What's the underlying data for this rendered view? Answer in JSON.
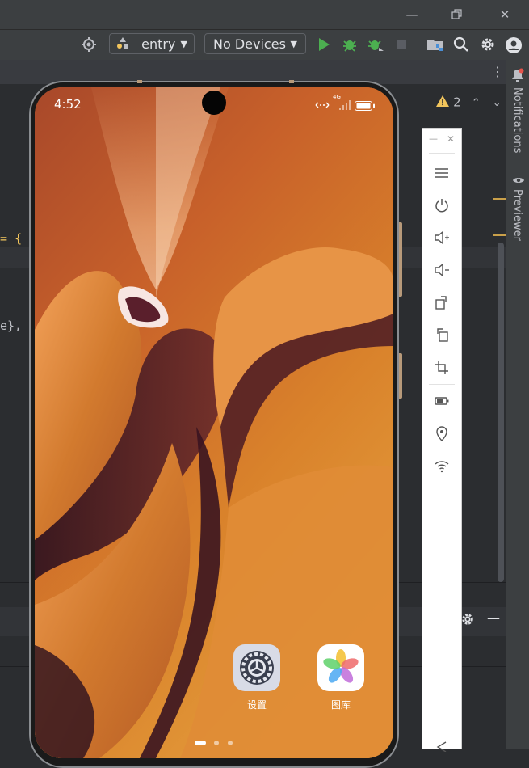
{
  "toolbar": {
    "module_name": "entry",
    "device_selector": "No Devices"
  },
  "code": {
    "line_brace": "{",
    "line_e_brace": "e},"
  },
  "inspections": {
    "warning_count": "2"
  },
  "side_tabs": {
    "notifications": "Notifications",
    "previewer": "Previewer"
  },
  "device": {
    "time": "4:52",
    "network_label": "4G",
    "apps": [
      {
        "label": "设置",
        "icon": "settings-icon"
      },
      {
        "label": "图库",
        "icon": "gallery-icon"
      }
    ],
    "page_indicator": {
      "pages": 3,
      "current": 1
    }
  },
  "emulator_controls": [
    "menu-icon",
    "power-icon",
    "volume-up-icon",
    "volume-down-icon",
    "rotate-clockwise-icon",
    "rotate-counterclockwise-icon",
    "screenshot-crop-icon",
    "battery-icon",
    "location-icon",
    "wifi-icon",
    "back-icon"
  ],
  "colors": {
    "run_green": "#4caf50",
    "warning_yellow": "#f2c55c",
    "wallpaper_orange": "#d9822b"
  }
}
